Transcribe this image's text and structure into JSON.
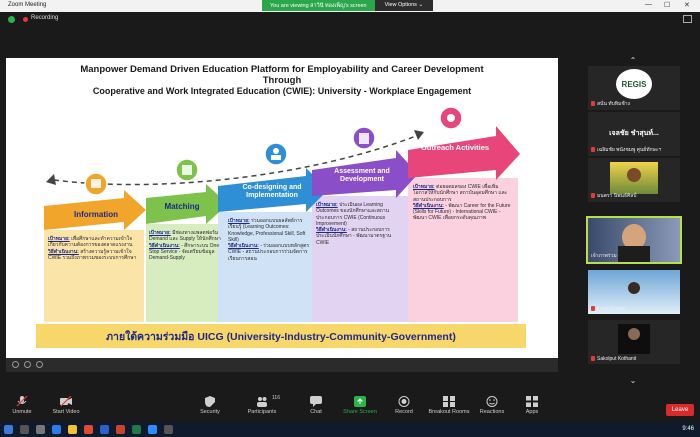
{
  "window": {
    "title": "Zoom Meeting",
    "viewing_text": "You are viewing สาวินี ทองเพ็ญ's screen",
    "view_options_label": "View Options ⌄",
    "recording_label": "Recording"
  },
  "slide": {
    "title_line1": "Manpower Demand Driven Education Platform for Employability and Career Development",
    "title_line2": "Through",
    "title_line3": "Cooperative and Work Integrated Education (CWIE): University - Workplace Engagement",
    "stages": [
      {
        "label": "Information",
        "color": "#f2a52b"
      },
      {
        "label": "Matching",
        "color": "#7dc24a"
      },
      {
        "label": "Co-designing and Implementation",
        "color": "#2f8fd6"
      },
      {
        "label": "Assessment and Development",
        "color": "#8a4fc8"
      },
      {
        "label": "Outreach Activities",
        "color": "#e8457a"
      }
    ],
    "panels": [
      {
        "head1": "เป้าหมาย:",
        "body1": "เพื่อศึกษาและทำความเข้าใจเกี่ยวกับความต้องการของตลาดแรงงาน",
        "head2": "วิธีดำเนินงาน:",
        "body2": "สร้างความรู้ความเข้าใจ CWIE รวมถึงภาพรวมของระบบการศึกษา"
      },
      {
        "head1": "เป้าหมาย:",
        "body1": "มีช่องทางแพลตฟอร์ม Demand และ Supply ให้นักศึกษา",
        "head2": "วิธีดำเนินงาน:",
        "body2": "- ศึกษาระบบ One Stop Service - จัดเตรียมข้อมูล Demand-Supply"
      },
      {
        "head1": "เป้าหมาย:",
        "body1": "ร่วมออกแบบผลลัพธ์การเรียนรู้ (Learning Outcomes: Knowledge, Professional Skill, Soft Skill)",
        "head2": "วิธีดำเนินงาน:",
        "body2": "- ร่วมออกแบบหลักสูตร CWIE - สถานประกอบการร่วมจัดการเรียนการสอน"
      },
      {
        "head1": "เป้าหมาย:",
        "body1": "ประเมินผล Learning Outcomes ของนักศึกษาและสถานประกอบการ CWIE (Continuous Improvement)",
        "head2": "วิธีดำเนินงาน:",
        "body2": "- สถานประกอบการประเมินนักศึกษา - พัฒนามาตรฐาน CWIE"
      },
      {
        "head1": "เป้าหมาย:",
        "body1": "ต่อยอดผลของ CWIE เพื่อเพิ่มโอกาสให้กับนักศึกษา สถาบันอุดมศึกษา และสถานประกอบการ",
        "head2": "วิธีดำเนินงาน:",
        "body2": "- พัฒนา Career for the Future (Skills for Future) - International CWIE - พัฒนา CWIE เพื่อยกระดับคุณภาพ"
      }
    ],
    "footer": "ภายใต้ความร่วมมือ UICG (University-Industry-Community-Government)"
  },
  "gallery": {
    "tiles": [
      {
        "name": "สนั่น ทับทิมช้าง",
        "logo": "REGIS",
        "kind": "logo"
      },
      {
        "name": "เฉลิมชัย พนังชมพู ศูนย์ทักษะฯ",
        "big": "เจลชัย ชำสุนท์...",
        "kind": "text"
      },
      {
        "name": "มนตรา นิพนธ์ศิลป์",
        "kind": "photo-yellow"
      },
      {
        "name": "เจ้าภาพร่วม",
        "kind": "photo-man",
        "active": true
      },
      {
        "name": "Kosin Korpai",
        "kind": "photo-sky"
      },
      {
        "name": "Sakolput Kothanit",
        "kind": "photo-dark"
      }
    ]
  },
  "toolbar": {
    "unmute": "Unmute",
    "start_video": "Start Video",
    "security": "Security",
    "participants": "Participants",
    "participants_count": "116",
    "chat": "Chat",
    "share_screen": "Share Screen",
    "record": "Record",
    "breakout_rooms": "Breakout Rooms",
    "reactions": "Reactions",
    "apps": "Apps",
    "leave": "Leave"
  },
  "taskbar": {
    "clock": "9:46"
  },
  "colors": {
    "share_green": "#2bb34a",
    "leave_red": "#d92b2b",
    "active_speaker": "#b6e04a"
  }
}
